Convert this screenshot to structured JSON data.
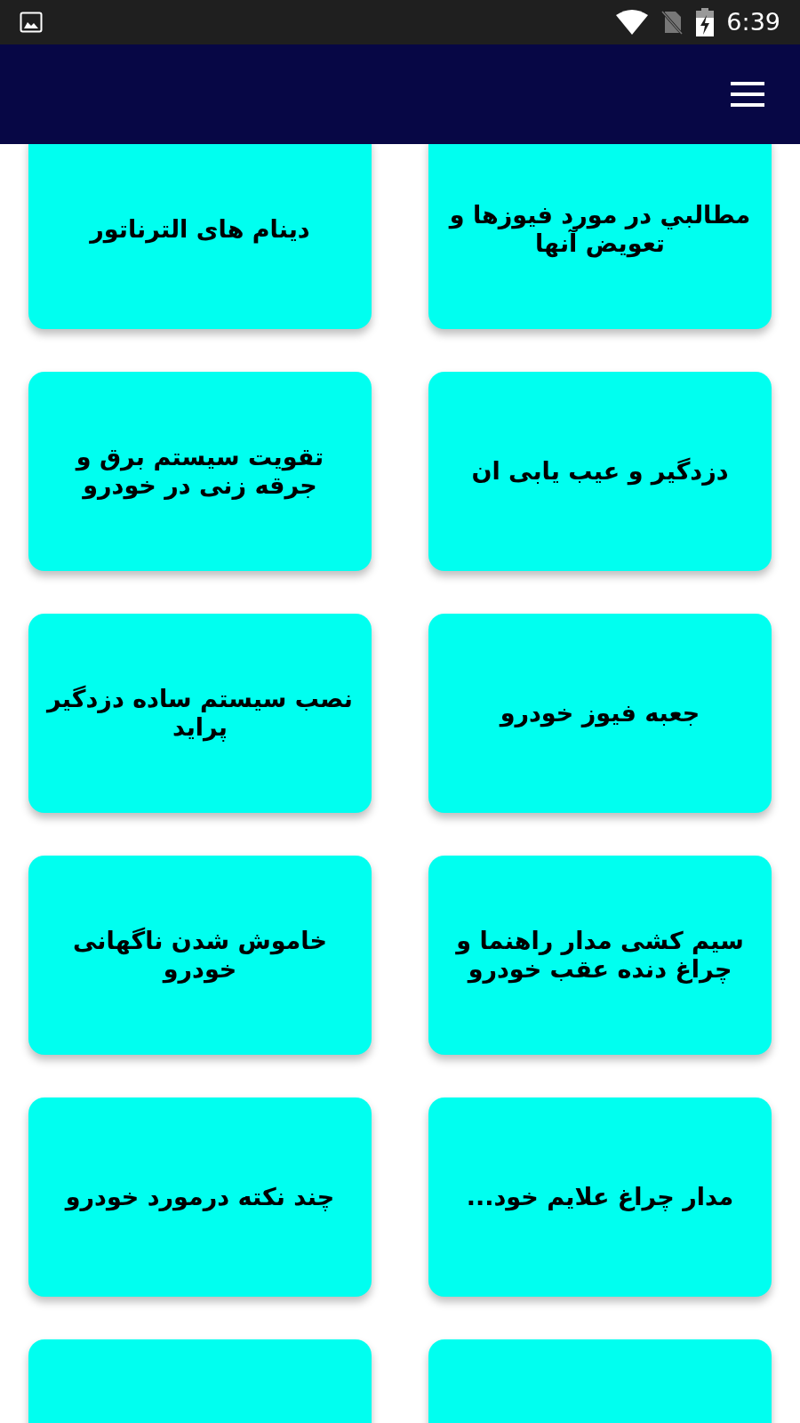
{
  "status_bar": {
    "time": "6:39"
  },
  "rows": [
    {
      "cards": [
        {
          "kind": "topic",
          "title": "مطالبي در مورد فیوزها و تعویض آنها"
        },
        {
          "kind": "topic",
          "title": "دینام های الترناتور"
        }
      ]
    },
    {
      "cards": [
        {
          "kind": "topic",
          "title": "دزدگیر و عیب یابی ان"
        },
        {
          "kind": "topic",
          "title": "تقویت سیستم برق و جرقه زنی در خودرو"
        }
      ]
    },
    {
      "cards": [
        {
          "kind": "topic",
          "title": "جعبه فیوز خودرو"
        },
        {
          "kind": "topic",
          "title": "نصب سیستم ساده دزدگیر پراید"
        }
      ]
    },
    {
      "cards": [
        {
          "kind": "topic",
          "title": "سیم کشی مدار راهنما و چراغ دنده عقب خودرو"
        },
        {
          "kind": "topic",
          "title": "خاموش شدن ناگهانی خودرو"
        }
      ]
    },
    {
      "cards": [
        {
          "kind": "topic",
          "title": "مدار چراغ علایم خود..."
        },
        {
          "kind": "topic",
          "title": "چند نکته درمورد خودرو"
        }
      ]
    },
    {
      "cards": [
        {
          "kind": "cut_off"
        },
        {
          "kind": "cut_off"
        }
      ]
    }
  ]
}
